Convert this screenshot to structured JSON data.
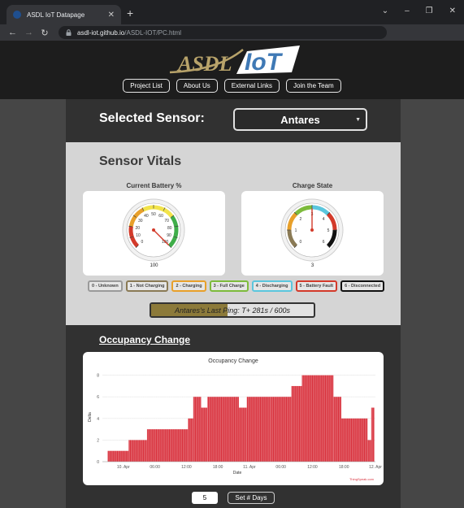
{
  "browser": {
    "tab_title": "ASDL IoT Datapage",
    "url_host": "asdl-iot.github.io",
    "url_path": "/ASDL-IOT/PC.html"
  },
  "header": {
    "logo_left": "ASDL",
    "logo_right": "IoT",
    "nav": [
      "Project List",
      "About Us",
      "External Links",
      "Join the Team"
    ]
  },
  "sensor": {
    "label": "Selected Sensor:",
    "selected": "Antares"
  },
  "vitals": {
    "title": "Sensor Vitals",
    "battery": {
      "title": "Current Battery %",
      "value": 100,
      "readout": "100",
      "min": 0,
      "max": 100,
      "ticks": [
        "0",
        "10",
        "20",
        "30",
        "40",
        "50",
        "60",
        "70",
        "80",
        "90",
        "100"
      ]
    },
    "charge": {
      "title": "Charge State",
      "value": 3,
      "readout": "3",
      "min": 0,
      "max": 6,
      "ticks": [
        "0",
        "1",
        "2",
        "3",
        "4",
        "5",
        "6"
      ]
    },
    "legend": [
      {
        "text": "0 - Unknown",
        "color": "#9a9a9a"
      },
      {
        "text": "1 - Not Charging",
        "color": "#8a7a55"
      },
      {
        "text": "2 - Charging",
        "color": "#e8a02a"
      },
      {
        "text": "3 - Full Charge",
        "color": "#7dbb3c"
      },
      {
        "text": "4 - Discharging",
        "color": "#5bc6dd"
      },
      {
        "text": "5 - Battery Fault",
        "color": "#d33a2a"
      },
      {
        "text": "6 - Disconnected",
        "color": "#111111"
      }
    ],
    "ping_text": "Antares's Last Ping: T+ 281s / 600s",
    "ping_fraction": 0.468
  },
  "occupancy": {
    "title": "Occupancy Change",
    "set_days_label": "Set # Days",
    "days_value": "5"
  },
  "colors": {
    "bar": "#d9333f",
    "logo_gold": "#b8a36a",
    "logo_blue": "#3f79b5"
  },
  "chart_data": {
    "type": "bar",
    "title": "Occupancy Change",
    "xlabel": "Date",
    "ylabel": "Delta",
    "ylim": [
      0,
      8.5
    ],
    "yticks": [
      0,
      2,
      4,
      6,
      8
    ],
    "xticks": [
      "10. Apr",
      "06:00",
      "12:00",
      "18:00",
      "11. Apr",
      "06:00",
      "12:00",
      "18:00",
      "12. Apr"
    ],
    "x_range_hours": [
      -4,
      48
    ],
    "credit": "ThingSpeak.com",
    "steps": [
      {
        "from": -3,
        "to": 1,
        "value": 1
      },
      {
        "from": 1,
        "to": 4.5,
        "value": 2
      },
      {
        "from": 4.5,
        "to": 12.3,
        "value": 3
      },
      {
        "from": 12.3,
        "to": 13.3,
        "value": 4
      },
      {
        "from": 13.3,
        "to": 14.8,
        "value": 6
      },
      {
        "from": 14.8,
        "to": 16,
        "value": 5
      },
      {
        "from": 16,
        "to": 22,
        "value": 6
      },
      {
        "from": 22,
        "to": 23.5,
        "value": 5
      },
      {
        "from": 23.5,
        "to": 28,
        "value": 6
      },
      {
        "from": 28,
        "to": 32,
        "value": 6
      },
      {
        "from": 32,
        "to": 34,
        "value": 7
      },
      {
        "from": 34,
        "to": 40,
        "value": 8
      },
      {
        "from": 40,
        "to": 41.5,
        "value": 6
      },
      {
        "from": 41.5,
        "to": 46.5,
        "value": 4
      },
      {
        "from": 46.5,
        "to": 47.2,
        "value": 2
      },
      {
        "from": 47.2,
        "to": 47.8,
        "value": 5
      }
    ]
  }
}
